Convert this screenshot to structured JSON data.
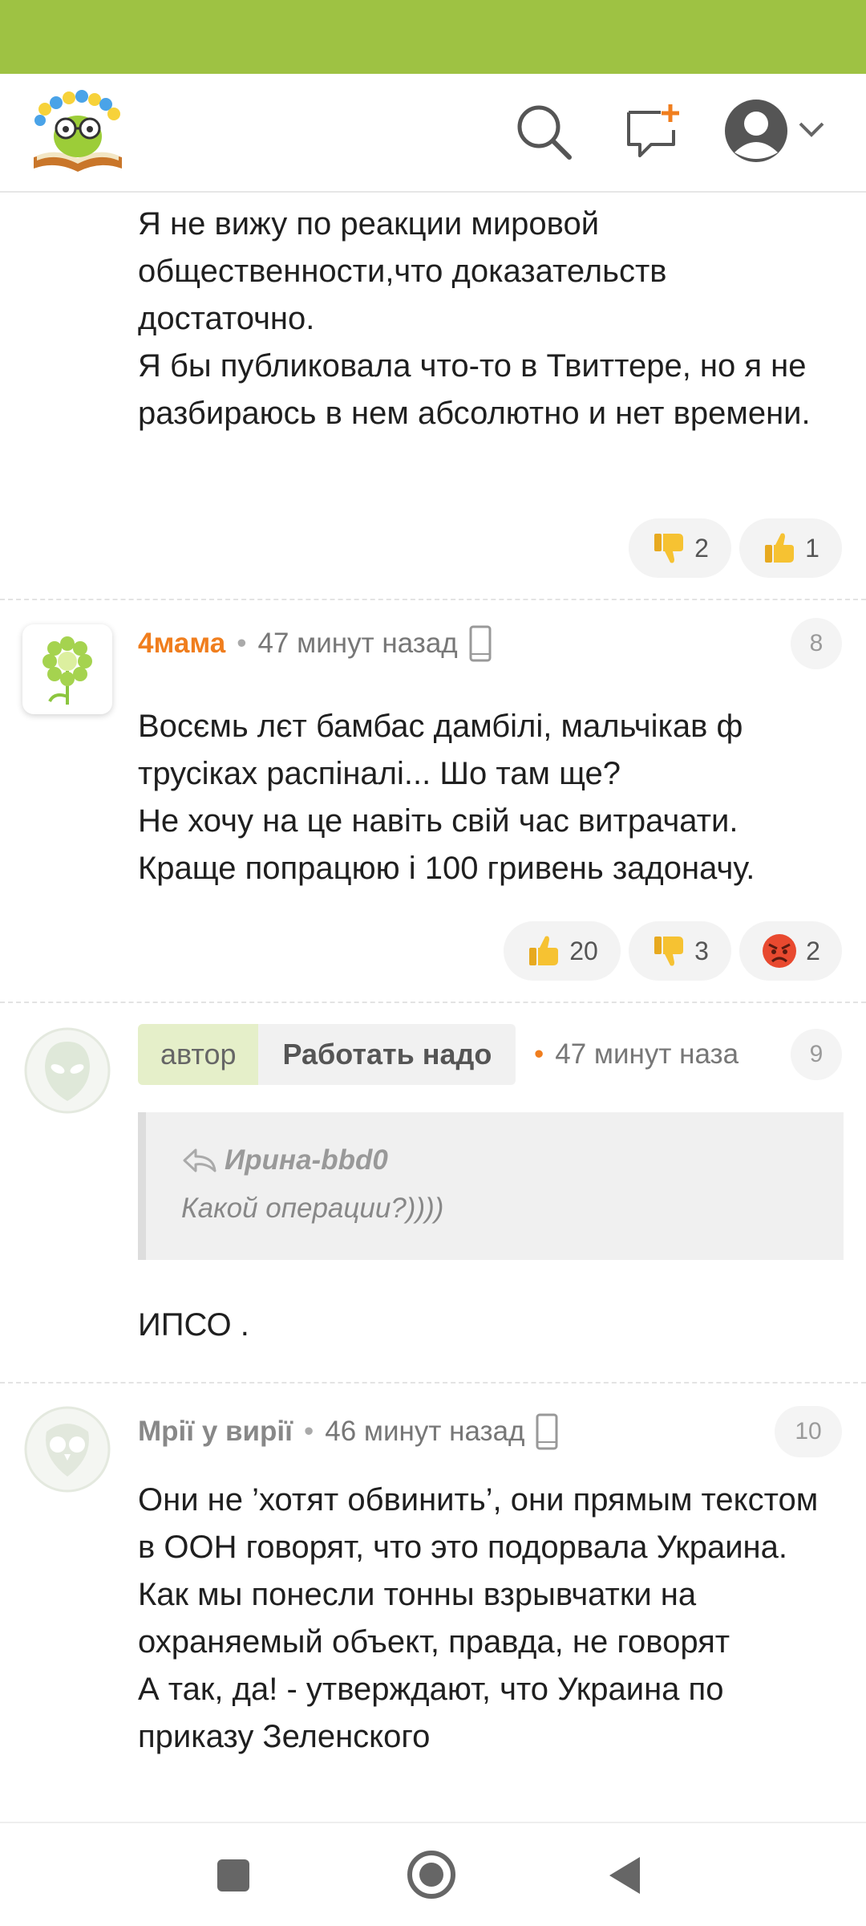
{
  "header": {
    "logo_name": "site-logo",
    "icons": [
      "search-icon",
      "new-post-icon",
      "profile-icon",
      "chevron-down-icon"
    ]
  },
  "comments": [
    {
      "lines": [
        "Я не вижу по реакции мировой общественности,что доказательств достаточно.",
        "Я бы публиковала что-то в Твиттере, но я не разбираюсь в нем абсолютно и нет времени."
      ],
      "reactions": [
        {
          "icon": "thumbs-down-icon",
          "count": "2"
        },
        {
          "icon": "thumbs-up-icon",
          "count": "1"
        }
      ]
    },
    {
      "author": "4мама",
      "time": "47 минут назад",
      "number": "8",
      "lines": [
        "Восємь лєт бамбас дамбілі, мальчікав ф трусіках распіналі... Шо там ще?",
        "Не хочу на це навіть свій час витрачати.",
        "Краще попрацюю і 100 гривень задоначу."
      ],
      "reactions": [
        {
          "icon": "thumbs-up-icon",
          "count": "20"
        },
        {
          "icon": "thumbs-down-icon",
          "count": "3"
        },
        {
          "icon": "angry-face-icon",
          "count": "2"
        }
      ]
    },
    {
      "author_tag": "автор",
      "author": "Работать надо",
      "time": "47 минут наза",
      "number": "9",
      "quote_author": "Ирина-bbd0",
      "quote_text": "Какой операции?))))",
      "lines": [
        "ИПСО ."
      ]
    },
    {
      "author": "Мрії у вирії",
      "time": "46 минут назад",
      "number": "10",
      "lines": [
        "Они не ’хотят обвинить’, они прямым текстом в ООН говорят, что это подорвала Украина.",
        "Как мы понесли тонны взрывчатки на охраняемый объект, правда, не говорят",
        "А так, да! - утверждают, что Украина по приказу Зеленского"
      ]
    }
  ],
  "colors": {
    "status_bar": "#9ec243",
    "accent_orange": "#f07e1e",
    "author_tag_bg": "#e5efc9"
  },
  "navbar": {
    "icons": [
      "recent-apps-icon",
      "home-icon",
      "back-icon"
    ]
  }
}
